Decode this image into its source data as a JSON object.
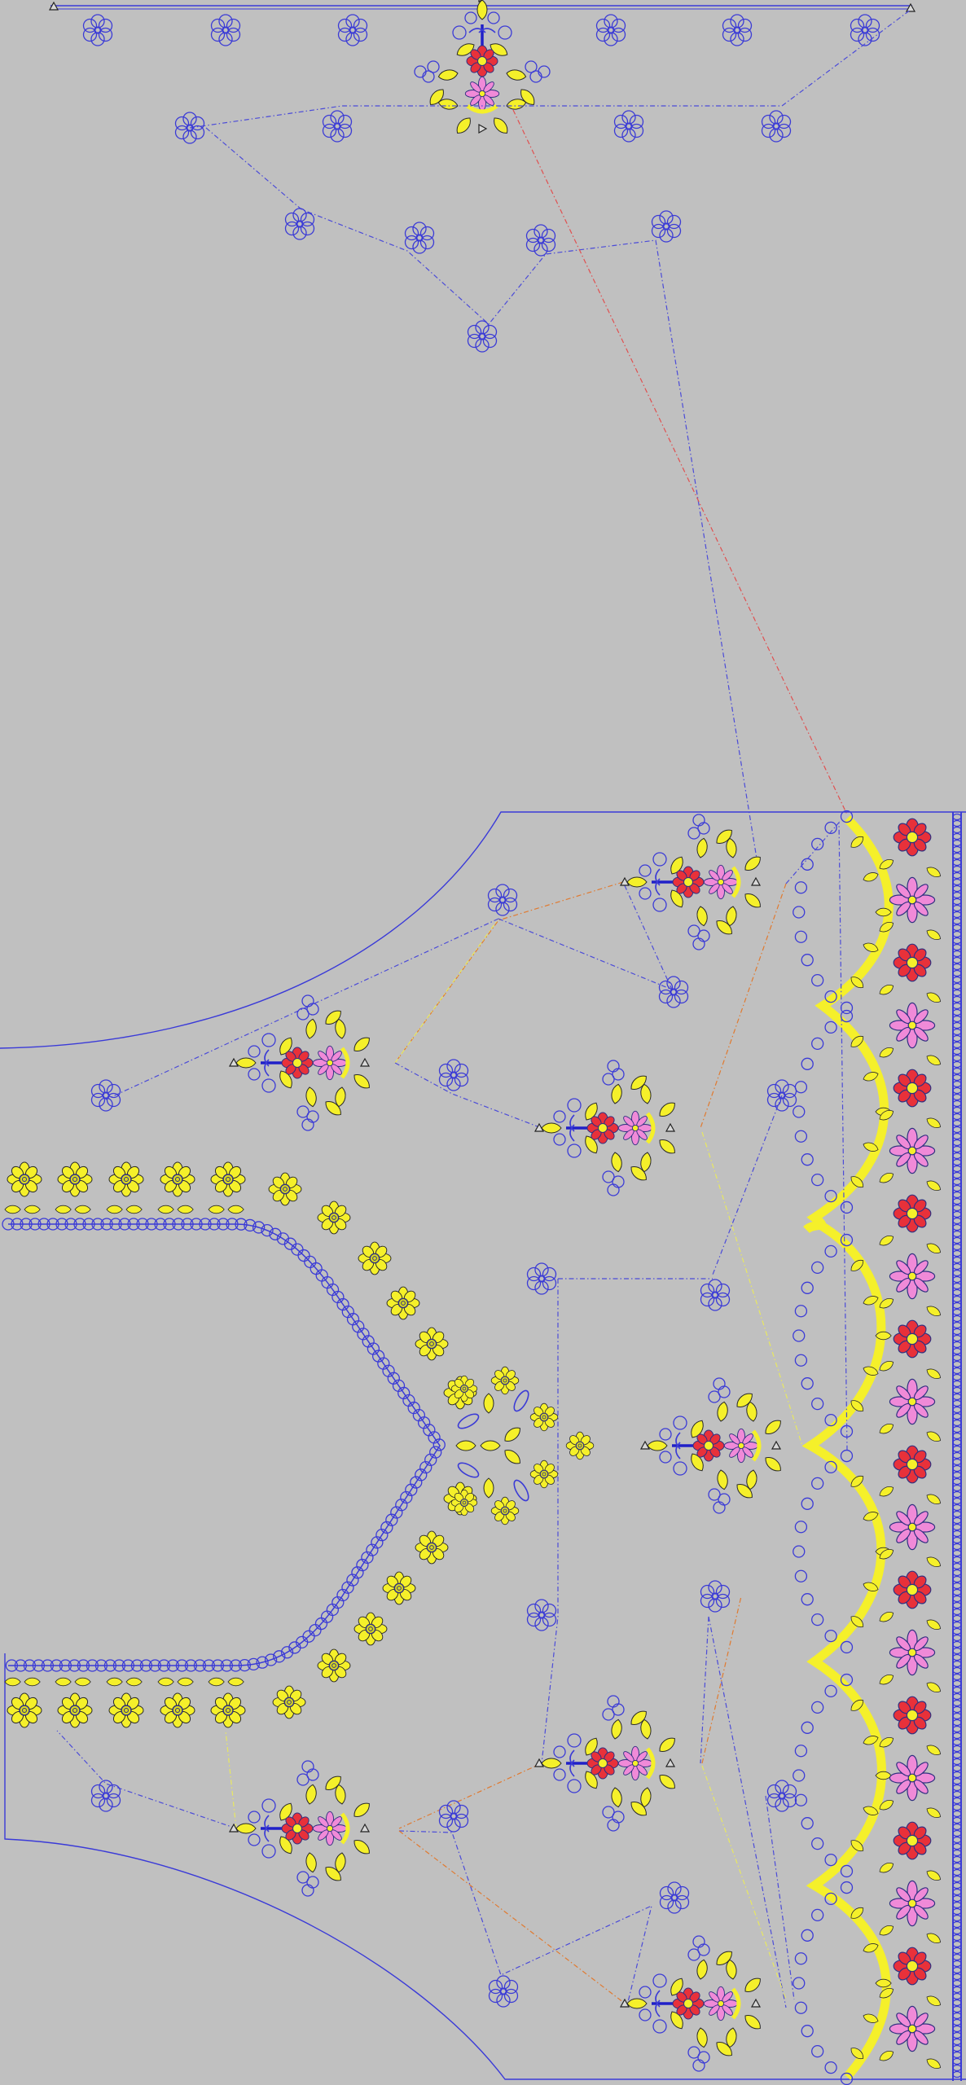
{
  "colors": {
    "background": "#c0c0c0",
    "outline_blue": "#3a3ad8",
    "thread_blue": "#3b3bd6",
    "thread_yellow": "#f5f02a",
    "thread_red": "#e8313a",
    "thread_pink": "#f08ad8",
    "jump_orange": "#e07a30",
    "jump_yellow": "#e8e860",
    "jump_red": "#e05050"
  }
}
